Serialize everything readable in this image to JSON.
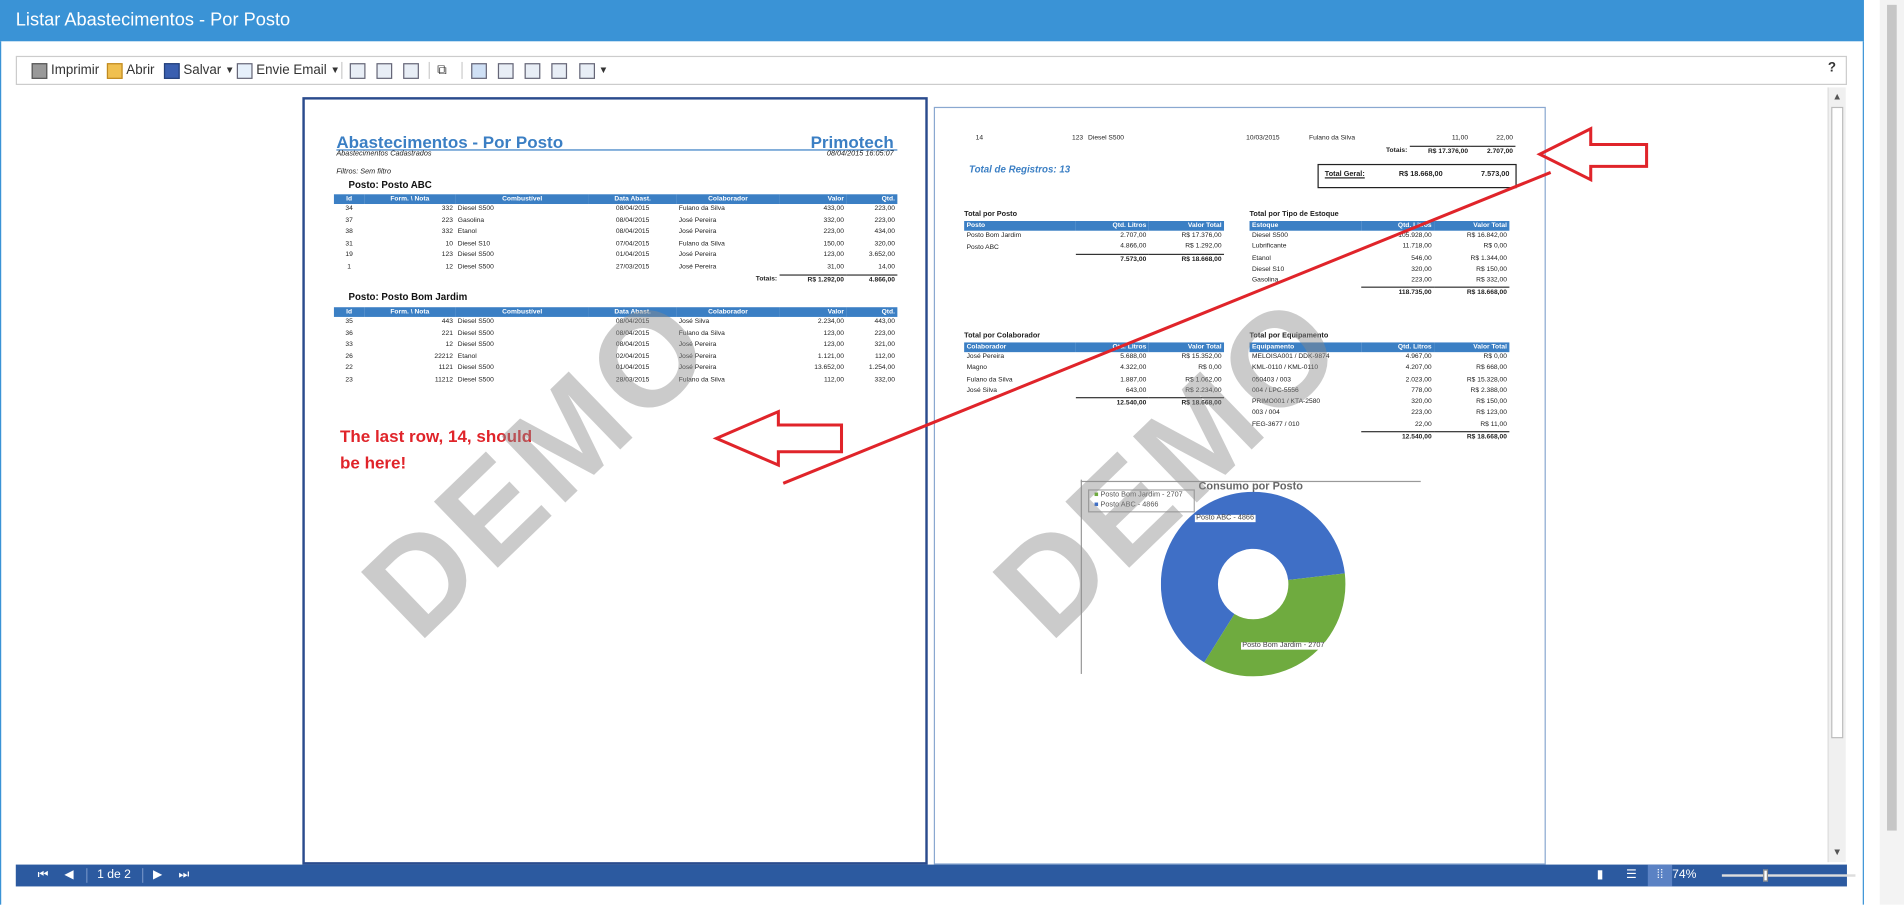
{
  "window": {
    "title": "Listar Abastecimentos - Por Posto"
  },
  "toolbar": {
    "print_label": "Imprimir",
    "open_label": "Abrir",
    "save_label": "Salvar",
    "email_label": "Envie Email",
    "help_label": "?"
  },
  "page1": {
    "title": "Abastecimentos - Por Posto",
    "brand": "Primotech",
    "subtitle": "Abastecimentos Cadastrados",
    "date": "08/04/2015 16:05:07",
    "filters": "Filtros: Sem filtro",
    "columns": [
      "Id",
      "Form. \\ Nota",
      "Combustível",
      "Data Abast.",
      "Colaborador",
      "Valor",
      "Qtd."
    ],
    "group1": {
      "header": "Posto:  Posto ABC",
      "rows": [
        [
          "34",
          "332",
          "Diesel S500",
          "08/04/2015",
          "Fulano da Silva",
          "433,00",
          "223,00"
        ],
        [
          "37",
          "223",
          "Gasolina",
          "08/04/2015",
          "José Pereira",
          "332,00",
          "223,00"
        ],
        [
          "38",
          "332",
          "Etanol",
          "08/04/2015",
          "José Pereira",
          "223,00",
          "434,00"
        ],
        [
          "31",
          "10",
          "Diesel S10",
          "07/04/2015",
          "Fulano da Silva",
          "150,00",
          "320,00"
        ],
        [
          "19",
          "123",
          "Diesel S500",
          "01/04/2015",
          "José Pereira",
          "123,00",
          "3.652,00"
        ],
        [
          "1",
          "12",
          "Diesel S500",
          "27/03/2015",
          "José Pereira",
          "31,00",
          "14,00"
        ]
      ],
      "totals_label": "Totais:",
      "total_valor": "R$ 1.292,00",
      "total_qtd": "4.866,00"
    },
    "group2": {
      "header": "Posto:  Posto Bom Jardim",
      "rows": [
        [
          "35",
          "443",
          "Diesel S500",
          "08/04/2015",
          "José Silva",
          "2.234,00",
          "443,00"
        ],
        [
          "36",
          "221",
          "Diesel S500",
          "08/04/2015",
          "Fulano da Silva",
          "123,00",
          "223,00"
        ],
        [
          "33",
          "12",
          "Diesel S500",
          "08/04/2015",
          "José Pereira",
          "123,00",
          "321,00"
        ],
        [
          "26",
          "22212",
          "Etanol",
          "02/04/2015",
          "José Pereira",
          "1.121,00",
          "112,00"
        ],
        [
          "22",
          "1121",
          "Diesel S500",
          "01/04/2015",
          "José Pereira",
          "13.652,00",
          "1.254,00"
        ],
        [
          "23",
          "11212",
          "Diesel S500",
          "28/03/2015",
          "Fulano da Silva",
          "112,00",
          "332,00"
        ]
      ]
    },
    "annotation": "The last row, 14, should\nbe here!"
  },
  "page2": {
    "row14": [
      "14",
      "123",
      "Diesel S500",
      "10/03/2015",
      "Fulano da Silva",
      "11,00",
      "22,00"
    ],
    "totals_label": "Totais:",
    "total_valor": "R$ 17.376,00",
    "total_qtd": "2.707,00",
    "grand_label": "Total Geral:",
    "grand_valor": "R$ 18.668,00",
    "grand_qtd": "7.573,00",
    "records_label": "Total de Registros:  13",
    "posto": {
      "title": "Total por Posto",
      "columns": [
        "Posto",
        "Qtd. Litros",
        "Valor Total"
      ],
      "rows": [
        [
          "Posto Bom Jardim",
          "2.707,00",
          "R$ 17.376,00"
        ],
        [
          "Posto ABC",
          "4.866,00",
          "R$ 1.292,00"
        ]
      ],
      "total": [
        "",
        "7.573,00",
        "R$ 18.668,00"
      ]
    },
    "estoque": {
      "title": "Total por Tipo de Estoque",
      "columns": [
        "Estoque",
        "Qtd. Litros",
        "Valor Total"
      ],
      "rows": [
        [
          "Diesel S500",
          "105.928,00",
          "R$ 16.842,00"
        ],
        [
          "Lubrificante",
          "11.718,00",
          "R$ 0,00"
        ],
        [
          "Etanol",
          "546,00",
          "R$ 1.344,00"
        ],
        [
          "Diesel S10",
          "320,00",
          "R$ 150,00"
        ],
        [
          "Gasolina",
          "223,00",
          "R$ 332,00"
        ]
      ],
      "total": [
        "",
        "118.735,00",
        "R$ 18.668,00"
      ]
    },
    "colaborador": {
      "title": "Total por Colaborador",
      "columns": [
        "Colaborador",
        "Qtd. Litros",
        "Valor Total"
      ],
      "rows": [
        [
          "José Pereira",
          "5.688,00",
          "R$ 15.352,00"
        ],
        [
          "Magno",
          "4.322,00",
          "R$ 0,00"
        ],
        [
          "Fulano da Silva",
          "1.887,00",
          "R$ 1.062,00"
        ],
        [
          "José Silva",
          "643,00",
          "R$ 2.234,00"
        ]
      ],
      "total": [
        "",
        "12.540,00",
        "R$ 18.668,00"
      ]
    },
    "equipamento": {
      "title": "Total por Equipamento",
      "columns": [
        "Equipamento",
        "Qtd. Litros",
        "Valor Total"
      ],
      "rows": [
        [
          "MELOISA001 / DDK-9874",
          "4.967,00",
          "R$ 0,00"
        ],
        [
          "KML-0110 / KML-0110",
          "4.207,00",
          "R$ 668,00"
        ],
        [
          "050403 / 003",
          "2.023,00",
          "R$ 15.328,00"
        ],
        [
          "004 / LPC-5556",
          "778,00",
          "R$ 2.388,00"
        ],
        [
          "PRIMO001 / KTA-2580",
          "320,00",
          "R$ 150,00"
        ],
        [
          "003 / 004",
          "223,00",
          "R$ 123,00"
        ],
        [
          "FEG-3677 / 010",
          "22,00",
          "R$ 11,00"
        ]
      ],
      "total": [
        "",
        "12.540,00",
        "R$ 18.668,00"
      ]
    },
    "chart": {
      "title": "Consumo por Posto",
      "legend": [
        "Posto Bom Jardim - 2707",
        "Posto ABC - 4866"
      ],
      "label_abc": "Posto ABC - 4866",
      "label_bj": "Posto Bom Jardim - 2707"
    }
  },
  "chart_data": {
    "type": "pie",
    "title": "Consumo por Posto",
    "categories": [
      "Posto ABC",
      "Posto Bom Jardim"
    ],
    "values": [
      4866,
      2707
    ],
    "colors": [
      "#3f6fc6",
      "#6fab3f"
    ],
    "donut": true
  },
  "watermark": "DEMO",
  "bottom": {
    "page_label": "1 de 2",
    "zoom": "74%"
  },
  "colors": {
    "titlebar": "#3a93d6",
    "header_fill": "#3b7fc4",
    "bottombar": "#2c5aa0",
    "annotation": "#e0242a"
  }
}
